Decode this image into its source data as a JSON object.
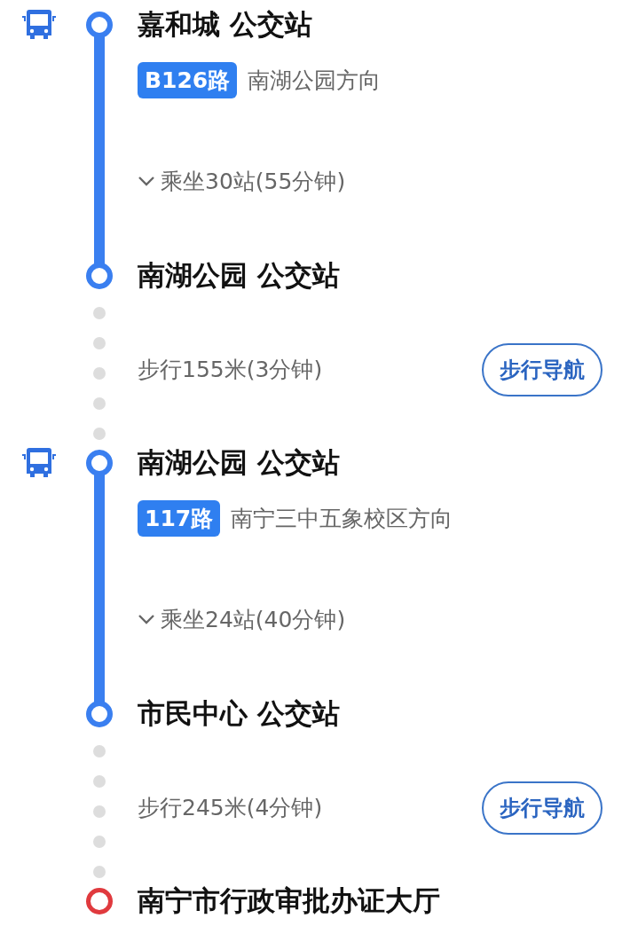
{
  "segments": [
    {
      "kind": "bus",
      "board_stop": "嘉和城 公交站",
      "route": "B126路",
      "direction": "南湖公园方向",
      "ride_info": "乘坐30站(55分钟)",
      "alight_stop": "南湖公园 公交站"
    },
    {
      "kind": "walk",
      "info": "步行155米(3分钟)",
      "button": "步行导航"
    },
    {
      "kind": "bus",
      "board_stop": "南湖公园 公交站",
      "route": "117路",
      "direction": "南宁三中五象校区方向",
      "ride_info": "乘坐24站(40分钟)",
      "alight_stop": "市民中心 公交站"
    },
    {
      "kind": "walk",
      "info": "步行245米(4分钟)",
      "button": "步行导航"
    }
  ],
  "destination": "南宁市行政审批办证大厅"
}
